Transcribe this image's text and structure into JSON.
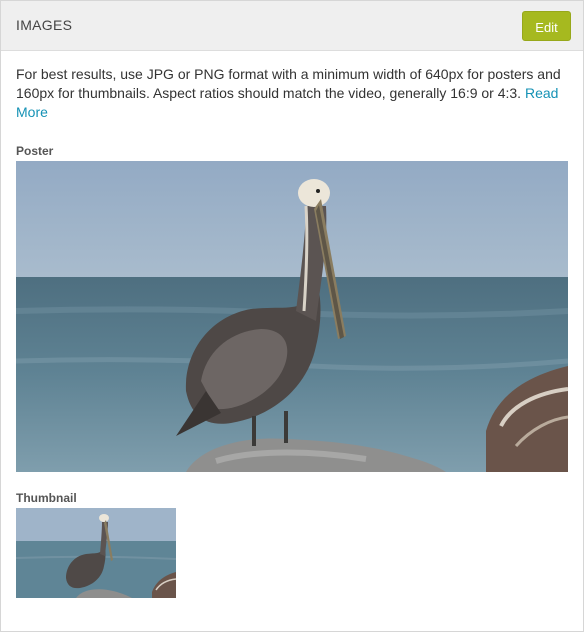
{
  "header": {
    "title": "IMAGES",
    "edit_label": "Edit"
  },
  "description": {
    "text": "For best results, use JPG or PNG format with a minimum width of 640px for posters and 160px for thumbnails. Aspect ratios should match the video, generally 16:9 or 4:3.",
    "link_text": "Read More"
  },
  "poster": {
    "label": "Poster"
  },
  "thumbnail": {
    "label": "Thumbnail"
  },
  "colors": {
    "accent": "#a6b91f",
    "link": "#1592b5",
    "header_bg": "#efefef"
  }
}
